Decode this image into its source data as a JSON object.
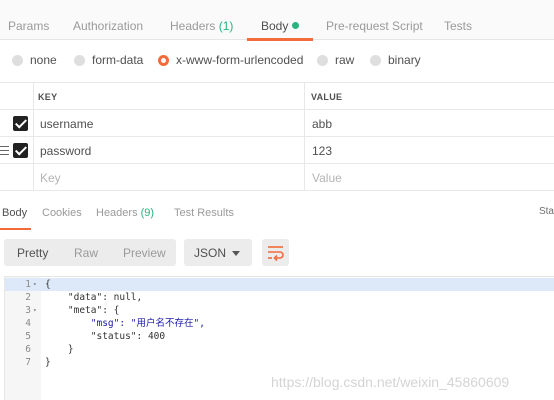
{
  "request_tabs": [
    {
      "label": "Params"
    },
    {
      "label": "Authorization"
    },
    {
      "label": "Headers",
      "count": "(1)"
    },
    {
      "label": "Body",
      "active": true
    },
    {
      "label": "Pre-request Script"
    },
    {
      "label": "Tests"
    }
  ],
  "body_types": [
    {
      "label": "none",
      "checked": false
    },
    {
      "label": "form-data",
      "checked": false
    },
    {
      "label": "x-www-form-urlencoded",
      "checked": true
    },
    {
      "label": "raw",
      "checked": false
    },
    {
      "label": "binary",
      "checked": false
    }
  ],
  "params_table": {
    "headers": [
      "KEY",
      "VALUE"
    ],
    "rows": [
      {
        "key": "username",
        "value": "abb",
        "enabled": true
      },
      {
        "key": "password",
        "value": "123",
        "enabled": true
      }
    ],
    "placeholder_row": {
      "key": "Key",
      "value": "Value"
    }
  },
  "response_tabs": [
    {
      "label": "Body",
      "active": true
    },
    {
      "label": "Cookies"
    },
    {
      "label": "Headers",
      "count": "(9)"
    },
    {
      "label": "Test Results"
    }
  ],
  "status_label_cut": "Sta",
  "view_modes": [
    "Pretty",
    "Raw",
    "Preview"
  ],
  "active_view_mode": "Pretty",
  "format_select": "JSON",
  "response_lines": [
    {
      "num": "1",
      "text": "{",
      "fold": true
    },
    {
      "num": "2",
      "text": "    \"data\": null,"
    },
    {
      "num": "3",
      "text": "    \"meta\": {",
      "fold": true
    },
    {
      "num": "4",
      "text": "        \"msg\": \"用户名不存在\","
    },
    {
      "num": "5",
      "text": "        \"status\": 400"
    },
    {
      "num": "6",
      "text": "    }"
    },
    {
      "num": "7",
      "text": "}"
    }
  ],
  "watermark": "https://blog.csdn.net/weixin_45860609",
  "colors": {
    "accent": "#f26b3a",
    "green": "#26b47f"
  }
}
